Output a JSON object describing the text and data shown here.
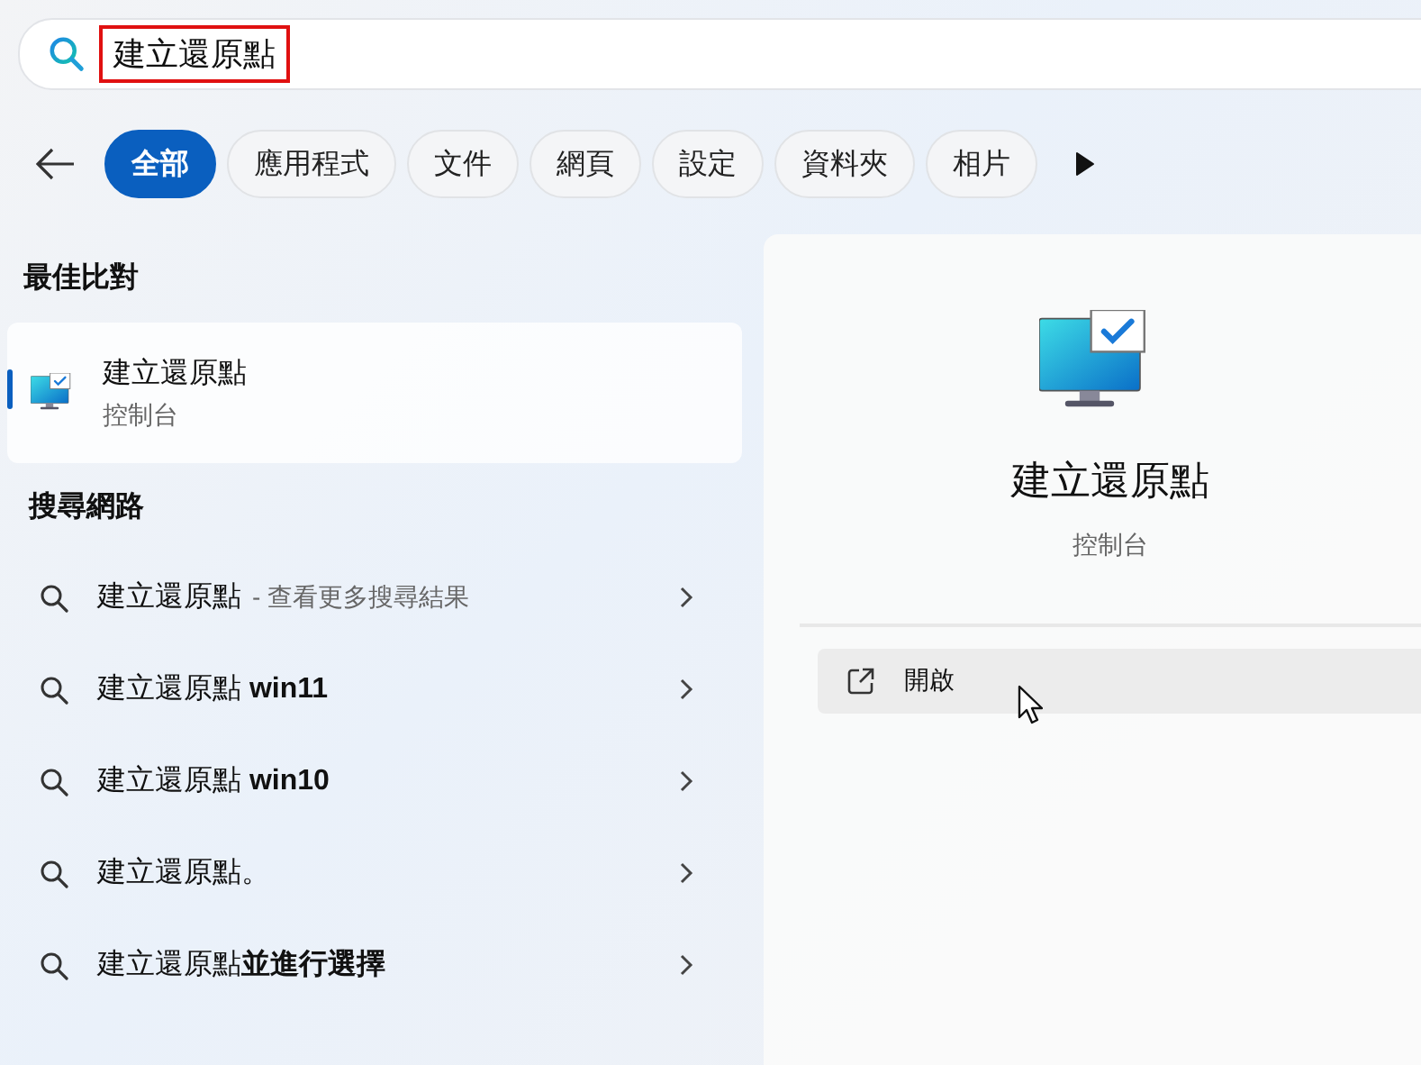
{
  "search": {
    "value": "建立還原點"
  },
  "filters": [
    {
      "label": "全部",
      "selected": true
    },
    {
      "label": "應用程式",
      "selected": false
    },
    {
      "label": "文件",
      "selected": false
    },
    {
      "label": "網頁",
      "selected": false
    },
    {
      "label": "設定",
      "selected": false
    },
    {
      "label": "資料夾",
      "selected": false
    },
    {
      "label": "相片",
      "selected": false
    }
  ],
  "best_match": {
    "heading": "最佳比對",
    "title": "建立還原點",
    "subtitle": "控制台",
    "selected": true
  },
  "web": {
    "heading": "搜尋網路",
    "items": [
      {
        "text": "建立還原點",
        "suffix": "- 查看更多搜尋結果"
      },
      {
        "text": "建立還原點 **win11**"
      },
      {
        "text": "建立還原點 **win10**"
      },
      {
        "text": "建立還原點。"
      },
      {
        "text": "建立還原點**並進行選擇**"
      }
    ]
  },
  "detail": {
    "title": "建立還原點",
    "subtitle": "控制台",
    "actions": [
      {
        "label": "開啟"
      }
    ]
  }
}
